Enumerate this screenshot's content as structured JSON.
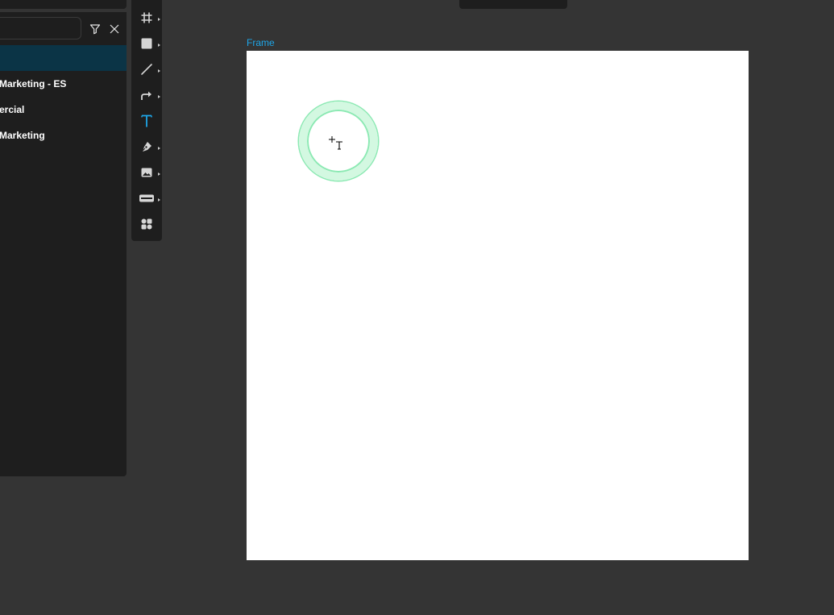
{
  "layers_panel": {
    "rows": [
      {
        "label": ""
      },
      {
        "label": "Marketing - ES"
      },
      {
        "label": "ercial"
      },
      {
        "label": "Marketing"
      }
    ]
  },
  "toolbar": {
    "tools": [
      {
        "icon": "frame-icon",
        "active": false
      },
      {
        "icon": "rectangle-icon",
        "active": false
      },
      {
        "icon": "line-icon",
        "active": false
      },
      {
        "icon": "connector-icon",
        "active": false
      },
      {
        "icon": "text-icon",
        "active": true
      },
      {
        "icon": "pen-icon",
        "active": false
      },
      {
        "icon": "image-icon",
        "active": false
      },
      {
        "icon": "widget-icon",
        "active": false
      },
      {
        "icon": "components-icon",
        "active": false
      }
    ]
  },
  "canvas": {
    "frame_label": "Frame"
  },
  "colors": {
    "accent": "#1ea6e8",
    "selected_row": "#0b3446",
    "panel_bg": "#1e1e1e",
    "canvas_bg": "#343434",
    "cursor_ring": "#8ce9b3"
  }
}
